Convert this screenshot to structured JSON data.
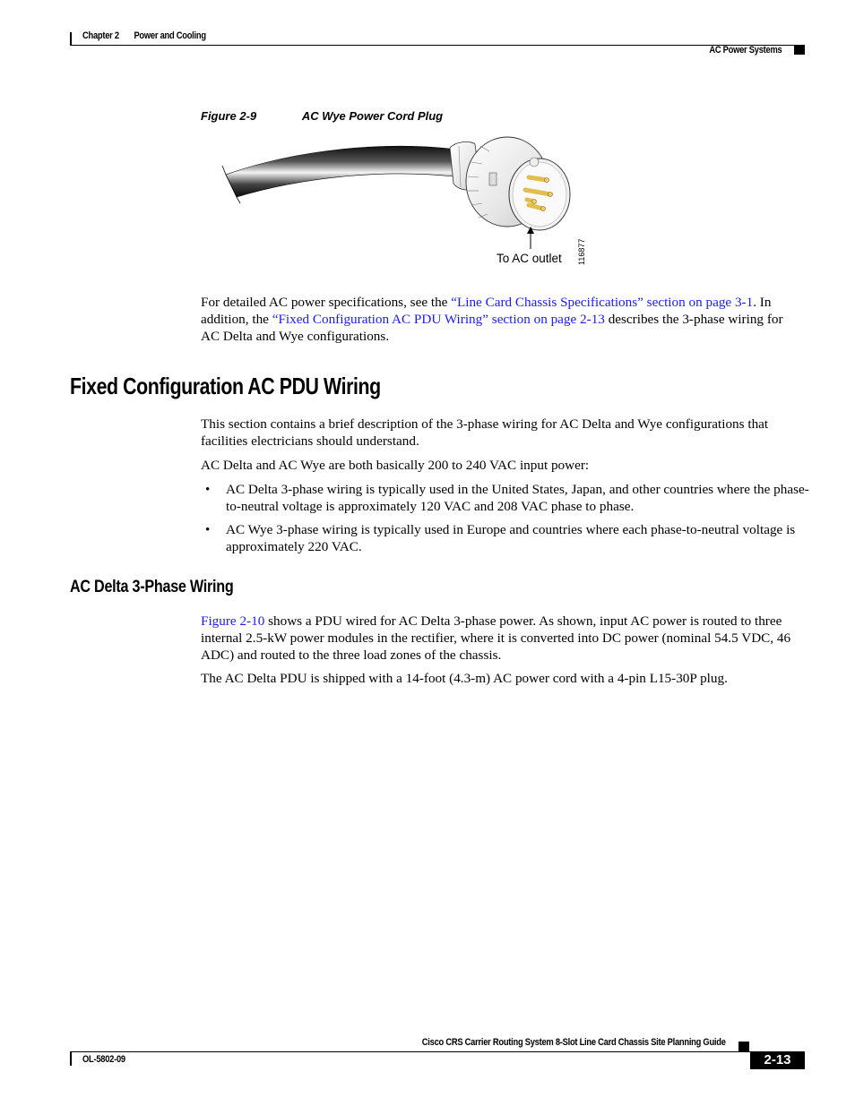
{
  "header": {
    "chapter": "Chapter 2",
    "chapter_title": "Power and Cooling",
    "section": "AC Power Systems"
  },
  "figure": {
    "number": "Figure 2-9",
    "title": "AC Wye Power Cord Plug",
    "callout": "To AC outlet",
    "art_id": "116877",
    "icon": "power-cord-plug-illustration"
  },
  "intro": {
    "text1": "For detailed AC power specifications, see the ",
    "link1": "“Line Card Chassis Specifications” section on page 3-1",
    "text2": ". In addition, the ",
    "link2": "“Fixed Configuration AC PDU Wiring” section on page 2-13",
    "text3": " describes the 3-phase wiring for AC Delta and Wye configurations."
  },
  "section1": {
    "heading": "Fixed Configuration AC PDU Wiring",
    "p1": "This section contains a brief description of the 3-phase wiring for AC Delta and Wye configurations that facilities electricians should understand.",
    "p2": "AC Delta and AC Wye are both basically 200 to 240 VAC input power:",
    "bullets": [
      "AC Delta 3-phase wiring is typically used in the United States, Japan, and other countries where the phase-to-neutral voltage is approximately 120 VAC and 208 VAC phase to phase.",
      "AC Wye 3-phase wiring is typically used in Europe and countries where each phase-to-neutral voltage is approximately 220 VAC."
    ],
    "bullet_glyph": "•"
  },
  "section2": {
    "heading": "AC Delta 3-Phase Wiring",
    "p1_link": "Figure 2-10",
    "p1_text": " shows a PDU wired for AC Delta 3-phase power. As shown, input AC power is routed to three internal 2.5-kW power modules in the rectifier, where it is converted into DC power (nominal 54.5 VDC, 46 ADC) and routed to the three load zones of the chassis.",
    "p2": "The AC Delta PDU is shipped with a 14-foot (4.3-m) AC power cord with a 4-pin L15-30P plug."
  },
  "footer": {
    "guide_title": "Cisco CRS Carrier Routing System 8-Slot Line Card Chassis Site Planning Guide",
    "doc_number": "OL-5802-09",
    "page_number": "2-13"
  }
}
